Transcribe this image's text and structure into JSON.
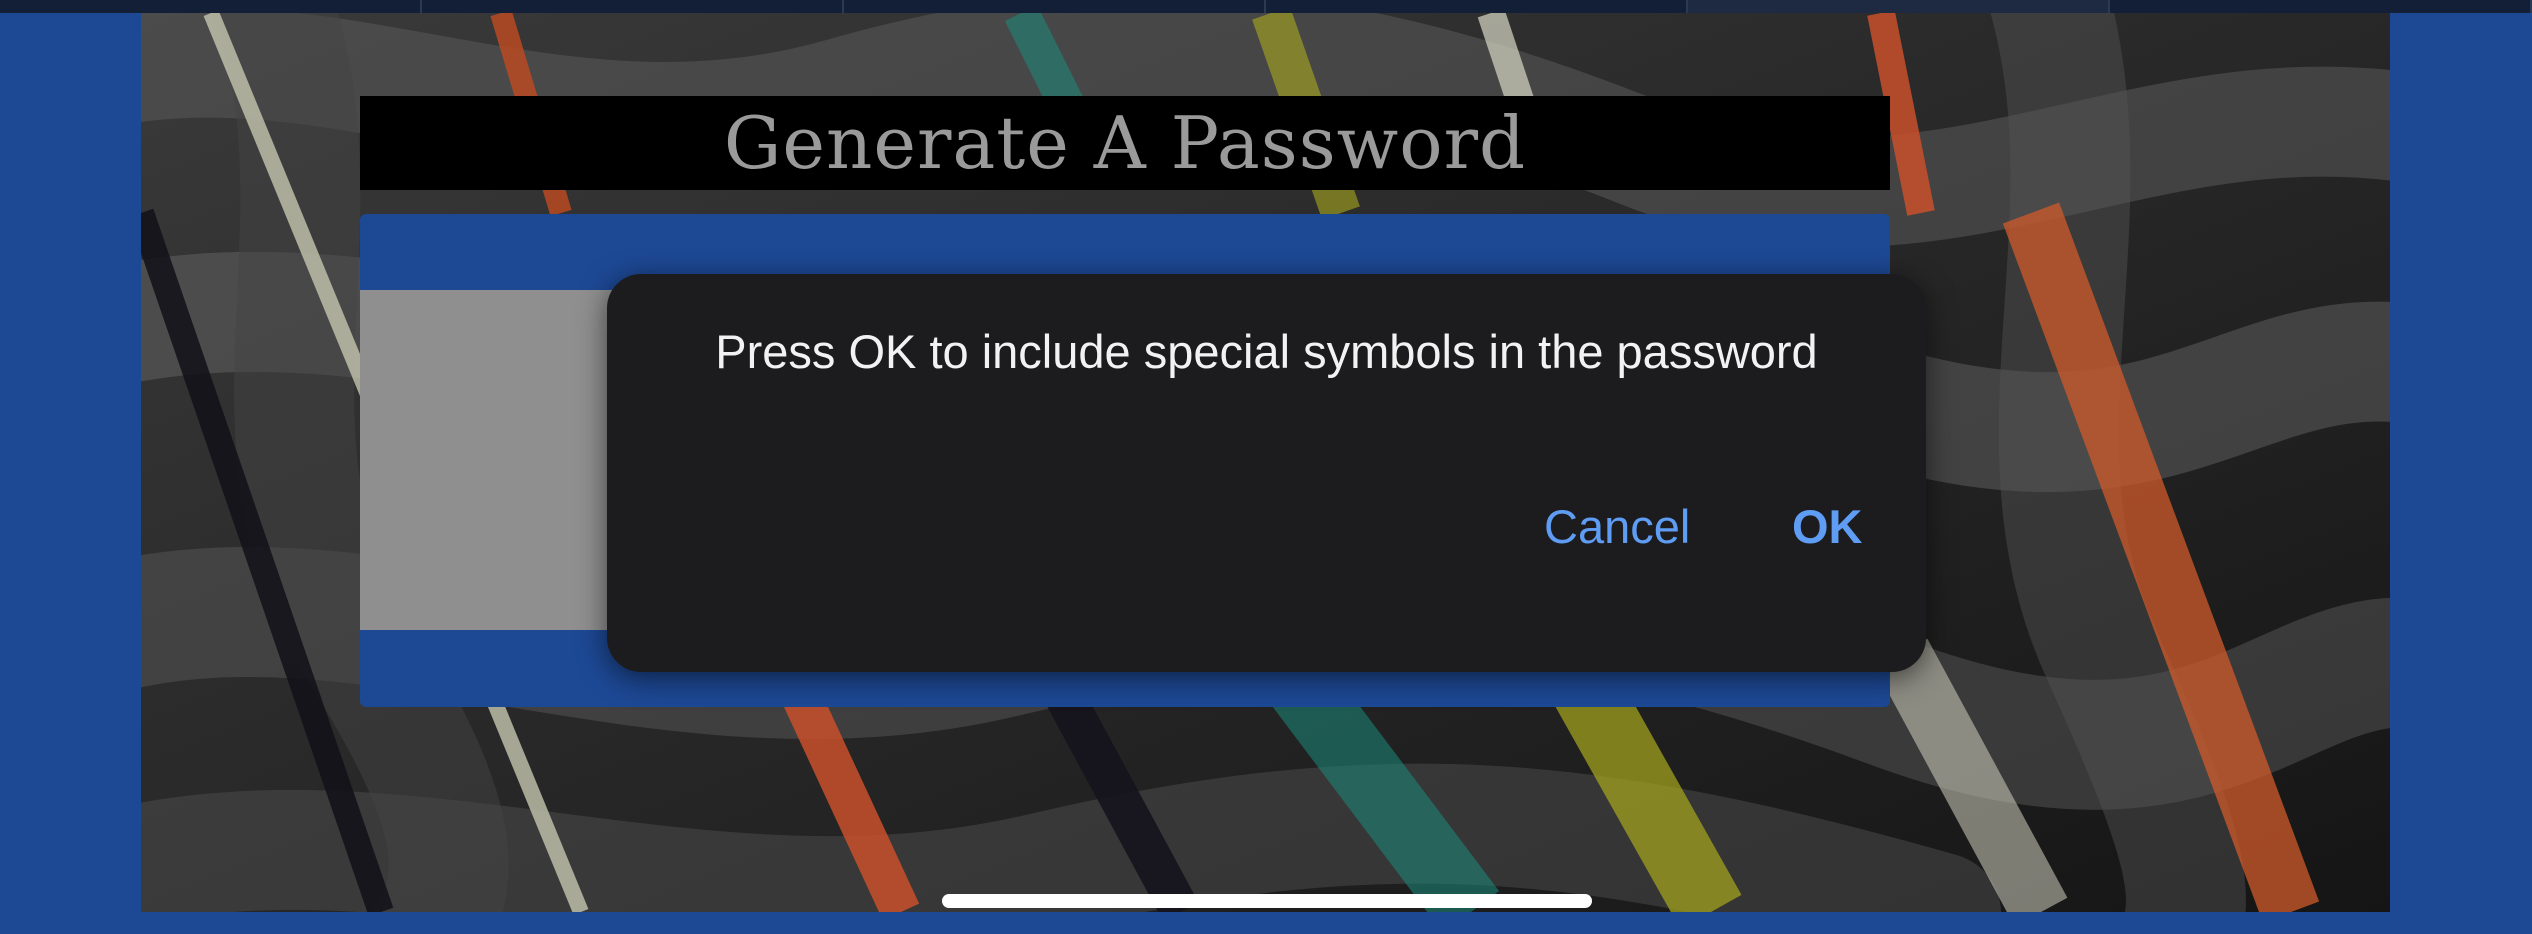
{
  "page": {
    "title": "Generate A Password"
  },
  "dialog": {
    "message": "Press OK to include special symbols in the password",
    "cancel_label": "Cancel",
    "ok_label": "OK"
  },
  "colors": {
    "background_blue": "#1d4894",
    "dialog_bg": "#1c1c1e",
    "button_text": "#5f9cf4",
    "title_text": "#9a9a9a"
  }
}
